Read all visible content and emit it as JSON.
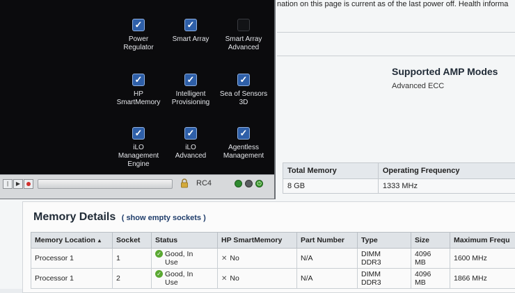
{
  "page": {
    "info_text": "nation on this page is current as of the last power off. Health informa",
    "amp": {
      "title": "Supported AMP Modes",
      "value": "Advanced ECC"
    },
    "summary": {
      "headers": [
        "Total Memory",
        "Operating Frequency"
      ],
      "row": [
        "8 GB",
        "1333 MHz"
      ]
    },
    "memory_details": {
      "title": "Memory Details",
      "link": "( show empty sockets )",
      "headers": [
        "Memory Location",
        "Socket",
        "Status",
        "HP SmartMemory",
        "Part Number",
        "Type",
        "Size",
        "Maximum Frequ"
      ],
      "rows": [
        {
          "location": "Processor 1",
          "socket": "1",
          "status_line1": "Good, In",
          "status_line2": "Use",
          "smartmemory": "No",
          "part": "N/A",
          "type1": "DIMM",
          "type2": "DDR3",
          "size1": "4096",
          "size2": "MB",
          "freq": "1600 MHz"
        },
        {
          "location": "Processor 1",
          "socket": "2",
          "status_line1": "Good, In",
          "status_line2": "Use",
          "smartmemory": "No",
          "part": "N/A",
          "type1": "DIMM",
          "type2": "DDR3",
          "size1": "4096",
          "size2": "MB",
          "freq": "1866 MHz"
        }
      ]
    }
  },
  "overlay": {
    "features": [
      {
        "line1": "Power",
        "line2": "Regulator",
        "line3": "",
        "checked": true
      },
      {
        "line1": "Smart Array",
        "line2": "",
        "line3": "",
        "checked": true
      },
      {
        "line1": "Smart Array",
        "line2": "Advanced",
        "line3": "",
        "checked": false
      },
      {
        "line1": "HP",
        "line2": "SmartMemory",
        "line3": "",
        "checked": true
      },
      {
        "line1": "Intelligent",
        "line2": "Provisioning",
        "line3": "",
        "checked": true
      },
      {
        "line1": "Sea of Sensors",
        "line2": "3D",
        "line3": "",
        "checked": true
      },
      {
        "line1": "iLO",
        "line2": "Management",
        "line3": "Engine",
        "checked": true
      },
      {
        "line1": "iLO",
        "line2": "Advanced",
        "line3": "",
        "checked": true
      },
      {
        "line1": "Agentless",
        "line2": "Management",
        "line3": "",
        "checked": true
      }
    ],
    "statusbar": {
      "label": "RC4"
    }
  },
  "icons": {
    "controls": [
      "first-icon",
      "play-icon",
      "record-icon"
    ],
    "lock": "lock-icon",
    "dots": [
      "green-status-icon",
      "grey-status-icon",
      "green-power-icon"
    ]
  },
  "colors": {
    "checkbox_on": "#2e5fa8",
    "overlay_bg": "#0b0b0d",
    "status_ok": "#5aa832",
    "record": "#d0302c"
  }
}
